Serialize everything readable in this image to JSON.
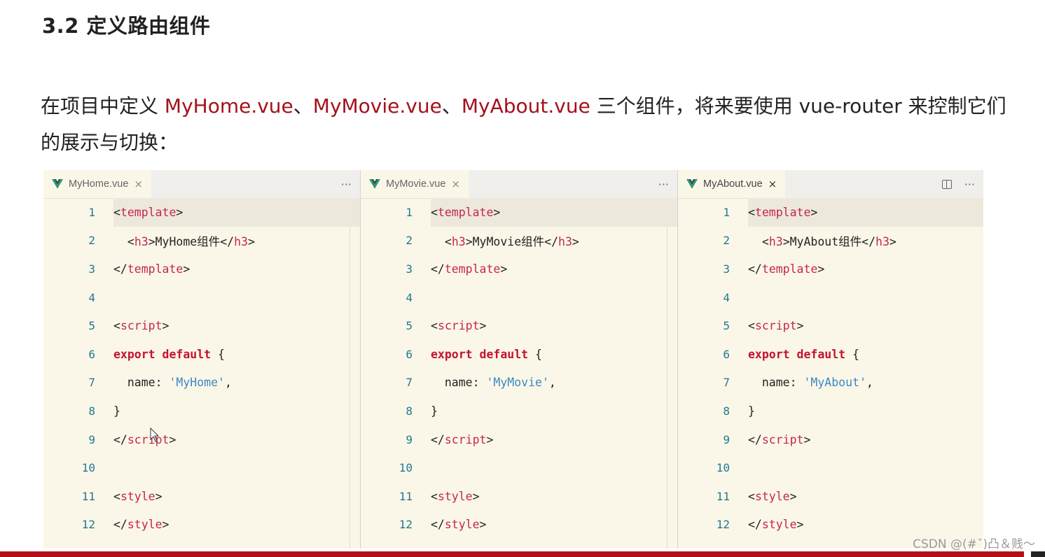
{
  "heading": "3.2 定义路由组件",
  "paragraph": {
    "prefix": "在项目中定义 ",
    "comp1": "MyHome.vue",
    "sep1": "、",
    "comp2": "MyMovie.vue",
    "sep2": "、",
    "comp3": "MyAbout.vue",
    "suffix": " 三个组件，将来要使用 vue-router 来控制它们的展示与切换："
  },
  "colors": {
    "accent": "#a3111c",
    "tag": "#c7254e",
    "keyword": "#c5132d",
    "string": "#3b88c4",
    "line_number": "#237893",
    "editor_bg": "#faf7e8"
  },
  "editors": [
    {
      "file": "MyHome.vue",
      "icon": "vue-logo-icon",
      "close": "×",
      "more": "···",
      "lines": [
        {
          "n": "1",
          "a": "<",
          "b": "template",
          "c": ">"
        },
        {
          "n": "2",
          "a": "  <",
          "b": "h3",
          "c": ">MyHome组件</",
          "d": "h3",
          "e": ">"
        },
        {
          "n": "3",
          "a": "</",
          "b": "template",
          "c": ">"
        },
        {
          "n": "4"
        },
        {
          "n": "5",
          "a": "<",
          "b": "script",
          "c": ">"
        },
        {
          "n": "6",
          "kw": "export default",
          "rest": " {"
        },
        {
          "n": "7",
          "a": "  name: ",
          "str": "'MyHome'",
          "end": ","
        },
        {
          "n": "8",
          "a": "}"
        },
        {
          "n": "9",
          "a": "</",
          "b": "script",
          "c": ">"
        },
        {
          "n": "10"
        },
        {
          "n": "11",
          "a": "<",
          "b": "style",
          "c": ">"
        },
        {
          "n": "12",
          "a": "</",
          "b": "style",
          "c": ">"
        }
      ]
    },
    {
      "file": "MyMovie.vue",
      "icon": "vue-logo-icon",
      "close": "×",
      "more": "···",
      "lines": [
        {
          "n": "1",
          "a": "<",
          "b": "template",
          "c": ">"
        },
        {
          "n": "2",
          "a": "  <",
          "b": "h3",
          "c": ">MyMovie组件</",
          "d": "h3",
          "e": ">"
        },
        {
          "n": "3",
          "a": "</",
          "b": "template",
          "c": ">"
        },
        {
          "n": "4"
        },
        {
          "n": "5",
          "a": "<",
          "b": "script",
          "c": ">"
        },
        {
          "n": "6",
          "kw": "export default",
          "rest": " {"
        },
        {
          "n": "7",
          "a": "  name: ",
          "str": "'MyMovie'",
          "end": ","
        },
        {
          "n": "8",
          "a": "}"
        },
        {
          "n": "9",
          "a": "</",
          "b": "script",
          "c": ">"
        },
        {
          "n": "10"
        },
        {
          "n": "11",
          "a": "<",
          "b": "style",
          "c": ">"
        },
        {
          "n": "12",
          "a": "</",
          "b": "style",
          "c": ">"
        }
      ]
    },
    {
      "file": "MyAbout.vue",
      "icon": "vue-logo-icon",
      "close": "×",
      "more": "···",
      "lines": [
        {
          "n": "1",
          "a": "<",
          "b": "template",
          "c": ">"
        },
        {
          "n": "2",
          "a": "  <",
          "b": "h3",
          "c": ">MyAbout组件</",
          "d": "h3",
          "e": ">"
        },
        {
          "n": "3",
          "a": "</",
          "b": "template",
          "c": ">"
        },
        {
          "n": "4"
        },
        {
          "n": "5",
          "a": "<",
          "b": "script",
          "c": ">"
        },
        {
          "n": "6",
          "kw": "export default",
          "rest": " {"
        },
        {
          "n": "7",
          "a": "  name: ",
          "str": "'MyAbout'",
          "end": ","
        },
        {
          "n": "8",
          "a": "}"
        },
        {
          "n": "9",
          "a": "</",
          "b": "script",
          "c": ">"
        },
        {
          "n": "10"
        },
        {
          "n": "11",
          "a": "<",
          "b": "style",
          "c": ">"
        },
        {
          "n": "12",
          "a": "</",
          "b": "style",
          "c": ">"
        }
      ]
    }
  ],
  "watermark": "CSDN @(#ˇ)凸＆贱～"
}
